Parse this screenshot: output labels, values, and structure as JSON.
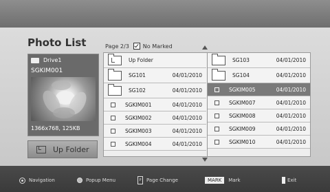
{
  "title": "Photo List",
  "page_info": {
    "page": "Page 2/3",
    "marked": "No Marked"
  },
  "info_card": {
    "drive": "Drive1",
    "name": "SGKIM001",
    "meta": "1366x768, 125KB"
  },
  "upfolder_button": {
    "label": "Up Folder"
  },
  "left_column": [
    {
      "type": "folder-up",
      "name": "Up Folder",
      "date": ""
    },
    {
      "type": "folder",
      "name": "SG101",
      "date": "04/01/2010"
    },
    {
      "type": "folder",
      "name": "SG102",
      "date": "04/01/2010"
    },
    {
      "type": "file",
      "name": "SGKIM001",
      "date": "04/01/2010"
    },
    {
      "type": "file",
      "name": "SGKIM002",
      "date": "04/01/2010"
    },
    {
      "type": "file",
      "name": "SGKIM003",
      "date": "04/01/2010"
    },
    {
      "type": "file",
      "name": "SGKIM004",
      "date": "04/01/2010"
    }
  ],
  "right_column": [
    {
      "type": "folder",
      "name": "SG103",
      "date": "04/01/2010"
    },
    {
      "type": "folder",
      "name": "SG104",
      "date": "04/01/2010"
    },
    {
      "type": "file",
      "name": "SGKIM005",
      "date": "04/01/2010",
      "selected": true
    },
    {
      "type": "file",
      "name": "SGKIM007",
      "date": "04/01/2010"
    },
    {
      "type": "file",
      "name": "SGKIM008",
      "date": "04/01/2010"
    },
    {
      "type": "file",
      "name": "SGKIM009",
      "date": "04/01/2010"
    },
    {
      "type": "file",
      "name": "SGKIM010",
      "date": "04/01/2010"
    }
  ],
  "footer": {
    "navigation": "Navigation",
    "popup": "Popup Menu",
    "page_change": "Page Change",
    "mark_key": "MARK",
    "mark": "Mark",
    "exit": "Exit"
  }
}
